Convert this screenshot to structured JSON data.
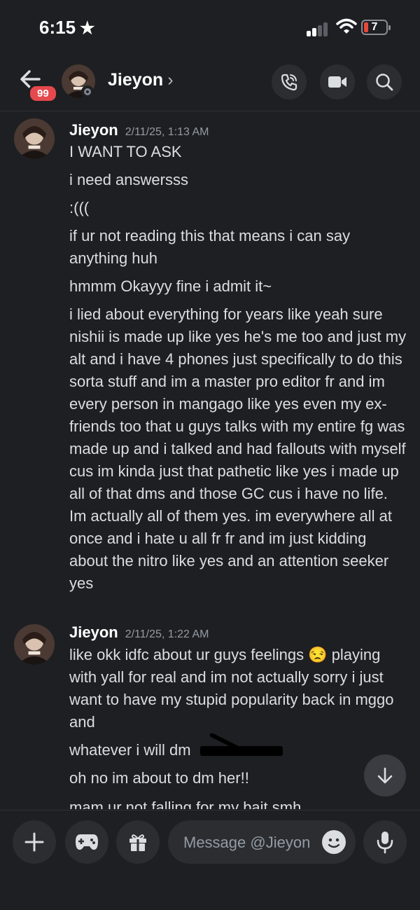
{
  "status_bar": {
    "time": "6:15",
    "battery": "7"
  },
  "header": {
    "name": "Jieyon",
    "chevron": "›",
    "unread_badge": "99"
  },
  "groups": [
    {
      "username": "Jieyon",
      "timestamp": "2/11/25, 1:13 AM",
      "messages": [
        "I WANT TO ASK",
        "i need answersss",
        ":(((",
        "if ur not reading this that means i can say anything huh",
        "hmmm Okayyy fine i admit it~",
        "i lied about everything for years like yeah sure nishii is made up like yes he's me too and just my alt and i have 4 phones just specifically to do this sorta stuff and im a master pro editor fr and im every person in mangago like yes even my ex-friends too that u guys talks with my entire fg was made up and i talked and had fallouts with myself cus im kinda just that pathetic like yes i made up all of that dms and those GC cus i have no life. Im actually all of them yes. im everywhere all at once and i hate u all fr fr and im just kidding about the nitro like yes and an attention seeker yes"
      ]
    },
    {
      "username": "Jieyon",
      "timestamp": "2/11/25, 1:22 AM",
      "messages": [
        "like okk idfc about ur guys feelings 😒 playing with yall for real and im not actually sorry i just want to have my stupid popularity back in mggo and",
        "whatever i will dm",
        "oh no im about to dm her!!",
        "mam ur not falling for my bait smh"
      ]
    }
  ],
  "composer": {
    "placeholder": "Message @Jieyon"
  },
  "colors": {
    "background": "#1e1f22",
    "badge": "#e5484d",
    "surface": "#2b2d31"
  }
}
